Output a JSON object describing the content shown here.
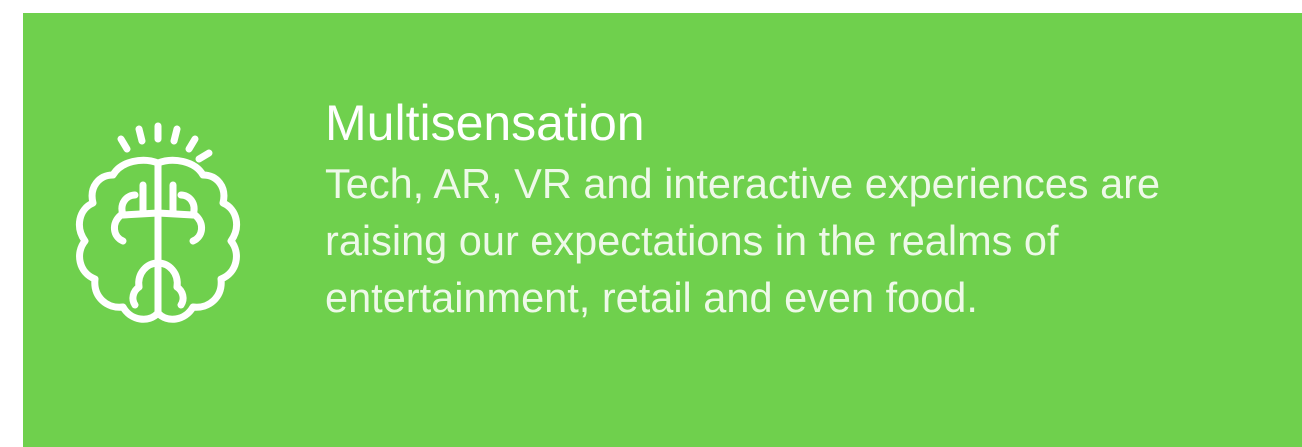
{
  "feature": {
    "icon": "brain-icon",
    "title": "Multisensation",
    "description": "Tech, AR, VR and interactive experiences are raising our expectations in the realms of entertainment, retail and even food.",
    "background_color": "#6fd04d",
    "text_color": "#ffffff"
  }
}
